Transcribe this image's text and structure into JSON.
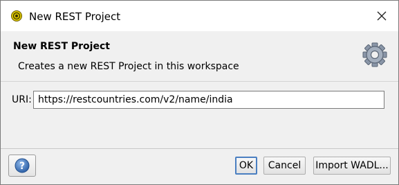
{
  "window": {
    "title": "New REST Project",
    "icon": "soapui-icon",
    "close_icon": "close-icon"
  },
  "header": {
    "title": "New REST Project",
    "description": "Creates a new REST Project in this workspace",
    "icon": "gear-icon"
  },
  "form": {
    "uri_label": "URI:",
    "uri_value": "https://restcountries.com/v2/name/india"
  },
  "footer": {
    "help_icon": "help-icon",
    "ok_label": "OK",
    "cancel_label": "Cancel",
    "import_label": "Import WADL..."
  },
  "colors": {
    "header_bg": "#f0f0f0",
    "default_button_border": "#4a7fc1",
    "help_icon": "#3a6fb5"
  }
}
